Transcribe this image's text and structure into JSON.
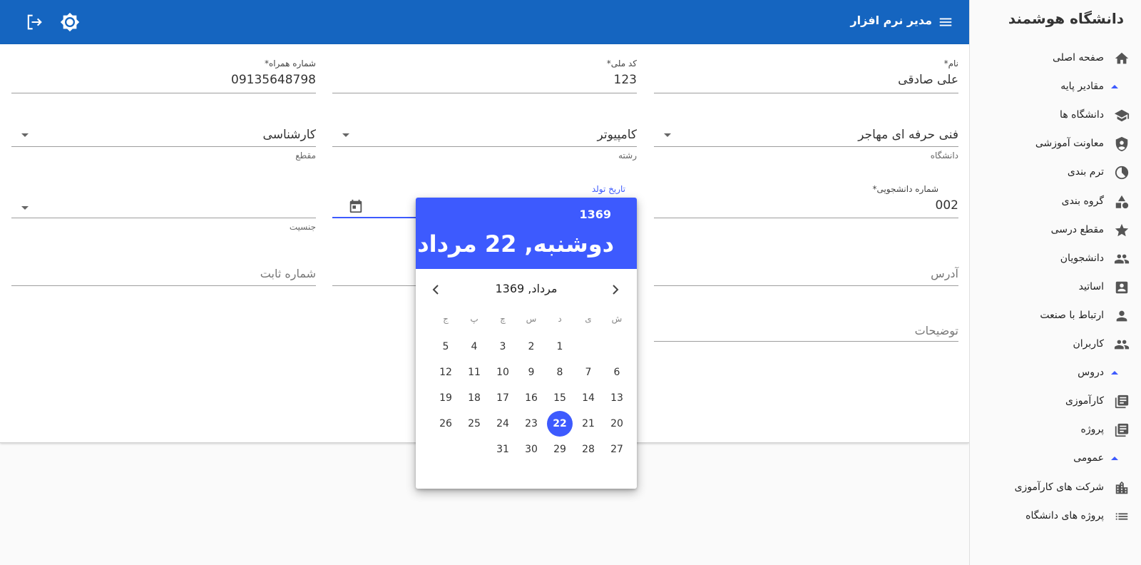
{
  "app": {
    "title": "مدیر نرم افزار",
    "brand": "دانشگاه هوشمند"
  },
  "form": {
    "name": {
      "label": "نام*",
      "value": "علی صادقی"
    },
    "national_code": {
      "label": "کد ملی*",
      "value": "123"
    },
    "mobile": {
      "label": "شماره همراه*",
      "value": "09135648798"
    },
    "university": {
      "value": "فنی حرفه ای مهاجر",
      "help": "دانشگاه"
    },
    "major": {
      "value": "کامپیوتر",
      "help": "رشته"
    },
    "degree": {
      "value": "کارشناسی",
      "help": "مقطع"
    },
    "student_number": {
      "label": "شماره دانشجویی*",
      "value": "002"
    },
    "birth_date": {
      "label": "تاریخ تولد"
    },
    "gender": {
      "help": "جنسیت"
    },
    "address": {
      "placeholder": "آدرس"
    },
    "phone": {
      "placeholder": "شماره ثابت"
    },
    "description": {
      "placeholder": "توضیحات"
    }
  },
  "sidebar": {
    "items": [
      {
        "label": "صفحه اصلی",
        "icon": "home-icon"
      },
      {
        "label": "مقادیر پایه",
        "group": true
      },
      {
        "label": "دانشگاه ها",
        "icon": "school-icon"
      },
      {
        "label": "معاونت آموزشی",
        "icon": "shield-account-icon"
      },
      {
        "label": "ترم بندی",
        "icon": "pie-chart-icon"
      },
      {
        "label": "گروه بندی",
        "icon": "shapes-icon"
      },
      {
        "label": "مقطع درسی",
        "icon": "star-icon"
      },
      {
        "label": "دانشجویان",
        "icon": "people-icon"
      },
      {
        "label": "اساتید",
        "icon": "contact-card-icon"
      },
      {
        "label": "ارتباط با صنعت",
        "icon": "person-icon"
      },
      {
        "label": "کاربران",
        "icon": "people-icon"
      },
      {
        "label": "دروس",
        "group": true
      },
      {
        "label": "کارآموزی",
        "icon": "library-books-icon"
      },
      {
        "label": "پروژه",
        "icon": "library-books-icon"
      },
      {
        "label": "عمومی",
        "group": true
      },
      {
        "label": "شرکت های کارآموزی",
        "icon": "building-icon"
      },
      {
        "label": "پروژه های دانشگاه",
        "icon": "list-icon"
      }
    ]
  },
  "datepicker": {
    "year": "1369",
    "selected_label": "دوشنبه, 22 مرداد",
    "month_label": "مرداد, 1369",
    "weekdays": [
      "ش",
      "ی",
      "د",
      "س",
      "چ",
      "پ",
      "ج"
    ],
    "weeks": [
      [
        "",
        "",
        "1",
        "2",
        "3",
        "4",
        "5"
      ],
      [
        "6",
        "7",
        "8",
        "9",
        "10",
        "11",
        "12"
      ],
      [
        "13",
        "14",
        "15",
        "16",
        "17",
        "18",
        "19"
      ],
      [
        "20",
        "21",
        "22",
        "23",
        "24",
        "25",
        "26"
      ],
      [
        "27",
        "28",
        "29",
        "30",
        "31",
        "",
        ""
      ]
    ],
    "selected_day": "22"
  },
  "colors": {
    "primary": "#1565c0",
    "accent": "#3d5afe"
  }
}
